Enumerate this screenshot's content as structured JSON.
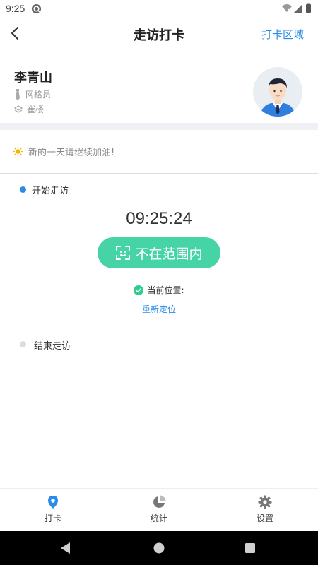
{
  "status_bar": {
    "time": "9:25"
  },
  "header": {
    "title": "走访打卡",
    "action_label": "打卡区域"
  },
  "profile": {
    "name": "李青山",
    "role": "网格员",
    "location": "崔楼"
  },
  "tip": {
    "text": "新的一天请继续加油!"
  },
  "timeline": {
    "start_label": "开始走访",
    "end_label": "结束走访"
  },
  "checkin": {
    "time": "09:25:24",
    "button_label": "不在范围内",
    "location_label": "当前位置:",
    "relocate_label": "重新定位"
  },
  "tabs": [
    {
      "label": "打卡",
      "icon": "location-pin-icon",
      "active": true
    },
    {
      "label": "统计",
      "icon": "pie-chart-icon",
      "active": false
    },
    {
      "label": "设置",
      "icon": "gear-icon",
      "active": false
    }
  ],
  "colors": {
    "accent": "#2a8be8",
    "button": "#46d3a6",
    "check": "#2ecc8f"
  }
}
